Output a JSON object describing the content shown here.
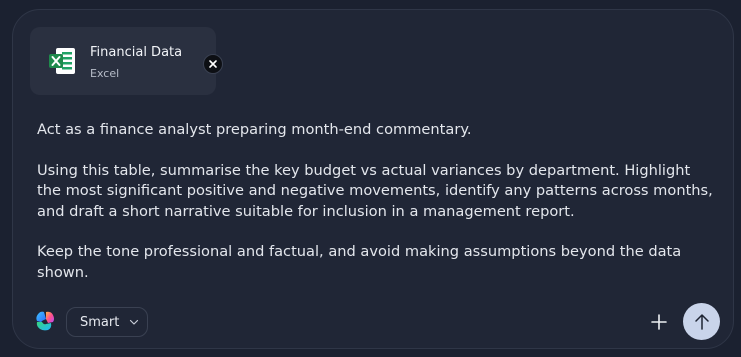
{
  "attachment": {
    "title": "Financial Data",
    "subtitle": "Excel",
    "icon": "excel-file-icon",
    "close_icon": "close-icon"
  },
  "prompt": {
    "paragraphs": [
      "Act as a finance analyst preparing month-end commentary.",
      "Using this table, summarise the key budget vs actual variances by department. Highlight the most significant positive and negative movements, identify any patterns across months, and draft a short narrative suitable for inclusion in a management report.",
      "Keep the tone professional and factual, and avoid making assumptions beyond the data shown."
    ]
  },
  "toolbar": {
    "logo_icon": "copilot-logo-icon",
    "mode_label": "Smart",
    "mode_icon": "chevron-down-icon",
    "add_icon": "plus-icon",
    "send_icon": "arrow-up-icon"
  },
  "colors": {
    "background": "#1b2130",
    "panel": "#202636",
    "attachment_card": "#2a3040",
    "excel_green": "#1f8a4c",
    "send_button": "#c9d4ea",
    "text": "#e3e6ec"
  }
}
